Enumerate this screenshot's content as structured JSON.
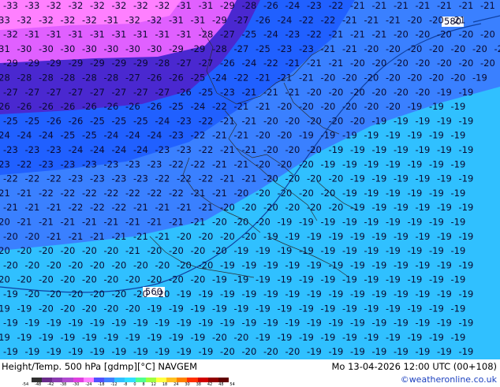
{
  "footer": {
    "title": "Height/Temp. 500 hPa [gdmp][°C] NAVGEM",
    "valid": "Mo 13-04-2026 12:00 UTC (00+108)",
    "credit": "©weatheronline.co.uk"
  },
  "contours": {
    "upper": "580",
    "lower": "560"
  },
  "scale": {
    "labels": [
      "-54",
      "-48",
      "-42",
      "-38",
      "-30",
      "-24",
      "-18",
      "-12",
      "-8",
      "0",
      "8",
      "12",
      "18",
      "24",
      "30",
      "38",
      "42",
      "48",
      "54"
    ],
    "colors": [
      "#303030",
      "#6a2a8a",
      "#8a3ab0",
      "#b04ad0",
      "#e040e0",
      "#ff80ff",
      "#5050ff",
      "#4080ff",
      "#30c0ff",
      "#30e0ff",
      "#50ff90",
      "#a0ff40",
      "#ffff40",
      "#ffc020",
      "#ff8000",
      "#ff3000",
      "#d00000",
      "#900000",
      "#600000"
    ]
  },
  "map_bands": [
    {
      "level": "-33",
      "color": "#ff80ff"
    },
    {
      "level": "-30",
      "color": "#e060ff"
    },
    {
      "level": "-27",
      "color": "#4a28d0"
    },
    {
      "level": "-24",
      "color": "#2060ff"
    },
    {
      "level": "-21",
      "color": "#3a80ff"
    },
    {
      "level": "-19",
      "color": "#30c0ff"
    }
  ],
  "temp_rows": [
    "-33 -33 -32 -32 -32 -32 -32 -32 -31 -31 -29 -28 -26 -24 -23 -22 -21 -21 -21 -21 -21 -21 -21 -21 -21",
    "-33 -32 -32 -32 -32 -31 -32 -32 -31 -31 -29 -27 -26 -24 -22 -22 -21 -21 -21 -20 -20 -21",
    "-32 -31 -31 -31 -31 -31 -31 -31 -31 -28 -27 -25 -24 -23 -22 -21 -21 -21 -20 -20 -20 -20 -20 -20",
    "-31 -30 -30 -30 -30 -30 -30 -30 -29 -29 -28 -27 -25 -23 -23 -21 -21 -20 -20 -20 -20 -20 -20 -20",
    "-29 -29 -29 -29 -29 -29 -29 -28 -27 -27 -26 -24 -22 -21 -21 -21 -20 -20 -20 -20 -20 -20 -20",
    "-28 -28 -28 -28 -28 -28 -27 -26 -26 -25 -24 -22 -21 -21 -21 -20 -20 -20 -20 -20 -20 -20 -19",
    "-27 -27 -27 -27 -27 -27 -27 -27 -26 -25 -23 -21 -21 -21 -20 -20 -20 -20 -20 -20 -19 -19",
    "-26 -26 -26 -26 -26 -26 -26 -26 -25 -24 -22 -21 -21 -20 -20 -20 -20 -20 -20 -19 -19 -19",
    "-25 -25 -26 -26 -25 -25 -25 -24 -23 -22 -21 -21 -20 -20 -20 -20 -20 -19 -19 -19 -19 -19",
    "-24 -24 -24 -25 -25 -24 -24 -24 -23 -22 -21 -21 -20 -20 -19 -19 -19 -19 -19 -19 -19 -19",
    "-23 -23 -23 -24 -24 -24 -24 -23 -23 -22 -21 -21 -20 -20 -20 -19 -19 -19 -19 -19 -19 -19",
    "-23 -22 -23 -23 -23 -23 -23 -23 -22 -22 -21 -21 -20 -20 -20 -19 -19 -19 -19 -19 -19 -19",
    "-22 -22 -22 -23 -23 -23 -23 -22 -22 -22 -21 -21 -20 -20 -20 -20 -19 -19 -19 -19 -19 -19",
    "-21 -21 -22 -22 -22 -22 -22 -22 -22 -21 -21 -20 -20 -20 -20 -20 -19 -19 -19 -19 -19 -19",
    "-21 -21 -21 -22 -22 -22 -21 -21 -21 -21 -20 -20 -20 -20 -20 -20 -19 -19 -19 -19 -19 -19",
    "-20 -21 -21 -21 -21 -21 -21 -21 -21 -21 -20 -20 -20 -19 -19 -19 -19 -19 -19 -19 -19 -19",
    "-20 -20 -21 -21 -21 -21 -21 -21 -20 -20 -20 -20 -19 -19 -19 -19 -19 -19 -19 -19 -19 -19",
    "-20 -20 -20 -20 -20 -20 -21 -20 -20 -20 -20 -19 -19 -19 -19 -19 -19 -19 -19 -19 -19 -19",
    "-20 -20 -20 -20 -20 -20 -20 -20 -20 -20 -19 -19 -19 -19 -19 -19 -19 -19 -19 -19 -19 -19",
    "-20 -20 -20 -20 -20 -20 -20 -20 -20 -20 -19 -19 -19 -19 -19 -19 -19 -19 -19 -19 -19 -19",
    "-19 -20 -20 -20 -20 -20 -20 -20 -19 -19 -19 -19 -19 -19 -19 -19 -19 -19 -19 -19 -19 -19",
    "-19 -19 -20 -20 -20 -20 -20 -19 -19 -19 -19 -19 -19 -19 -19 -19 -19 -19 -19 -19 -19 -19",
    "-19 -19 -19 -19 -19 -19 -19 -19 -19 -19 -19 -19 -19 -19 -19 -19 -19 -19 -19 -19 -19 -19",
    "-19 -19 -19 -19 -19 -19 -19 -19 -19 -19 -20 -20 -19 -19 -19 -19 -19 -19 -19 -19 -19 -19",
    "-19 -19 -19 -19 -19 -19 -19 -19 -19 -19 -20 -20 -20 -20 -19 -19 -19 -19 -19 -19 -19 -19"
  ]
}
